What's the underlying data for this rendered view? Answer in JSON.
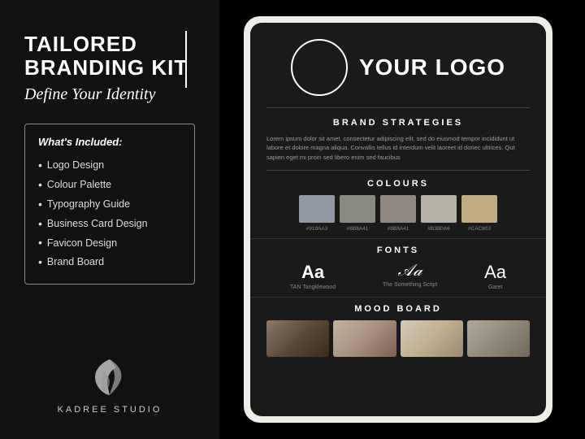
{
  "left": {
    "main_title_line1": "TAILORED",
    "main_title_line2": "BRANDING KIT",
    "italic_subtitle": "Define Your Identity",
    "whats_included_label": "What's Included:",
    "included_items": [
      "Logo Design",
      "Colour Palette",
      "Typography Guide",
      "Business Card Design",
      "Favicon Design",
      "Brand Board"
    ],
    "brand_name": "KADREE STUDIO"
  },
  "screen": {
    "logo_text": "YOUR LOGO",
    "brand_strategies_title": "BRAND STRATEGIES",
    "brand_desc": "Lorem ipsum dolor sit amet, consectetur adipiscing elit, sed do eiusmod tempor incididunt ut labore et dolore magna aliqua. Convallis tellus id interdum velit laoreet id donec ultrices. Qut sapien eget mi proin sed libero enim sed faucibus",
    "colours_title": "COLOURS",
    "swatches": [
      {
        "color": "#9198A3",
        "code": "#919AA3"
      },
      {
        "color": "#8B8A81",
        "code": "#8B8A41"
      },
      {
        "color": "#908880",
        "code": "#8B8A41"
      },
      {
        "color": "#B5B0A6",
        "code": "#B3B0A6"
      },
      {
        "color": "#C0AC83",
        "code": "#CAC603"
      }
    ],
    "fonts_title": "FONTS",
    "fonts": [
      {
        "display": "Aa",
        "name": "TAN Tangklewood",
        "style": "normal"
      },
      {
        "display": "𝒜𝒶",
        "name": "The Something Script",
        "style": "script"
      },
      {
        "display": "Aa",
        "name": "Garet",
        "style": "normal"
      }
    ],
    "mood_board_title": "MOOD BOARD"
  }
}
